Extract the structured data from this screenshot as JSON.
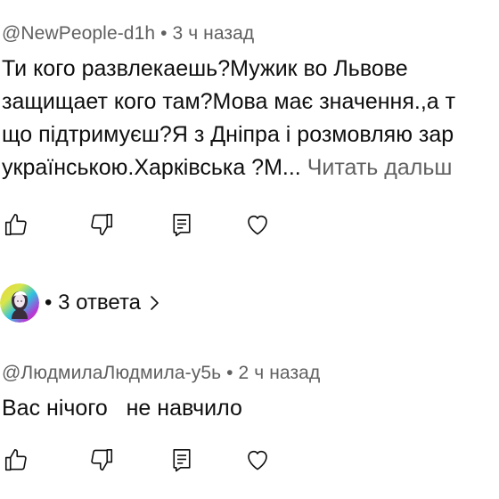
{
  "comments": [
    {
      "handle": "@NewPeople-d1h",
      "separator": "•",
      "time": "3 ч назад",
      "lines": [
        "Ти кого развлекаешь?Мужик во Львове",
        "защищает кого там?Мова має значення.,а т",
        "що підтримуєш?Я з Дніпра і розмовляю зар",
        "українською.Харківська ?М..."
      ],
      "read_more": "Читать дальш"
    },
    {
      "handle": "@ЛюдмилаЛюдмила-у5ь",
      "separator": "•",
      "time": "2 ч назад",
      "lines": [
        "Вас нічого   не навчило"
      ]
    }
  ],
  "replies": {
    "bullet": "•",
    "label": "3 ответа"
  },
  "icons": {
    "like": "thumbs-up-icon",
    "dislike": "thumbs-down-icon",
    "reply": "comment-reply-icon",
    "heart": "heart-icon",
    "chevron": "chevron-right-icon"
  }
}
